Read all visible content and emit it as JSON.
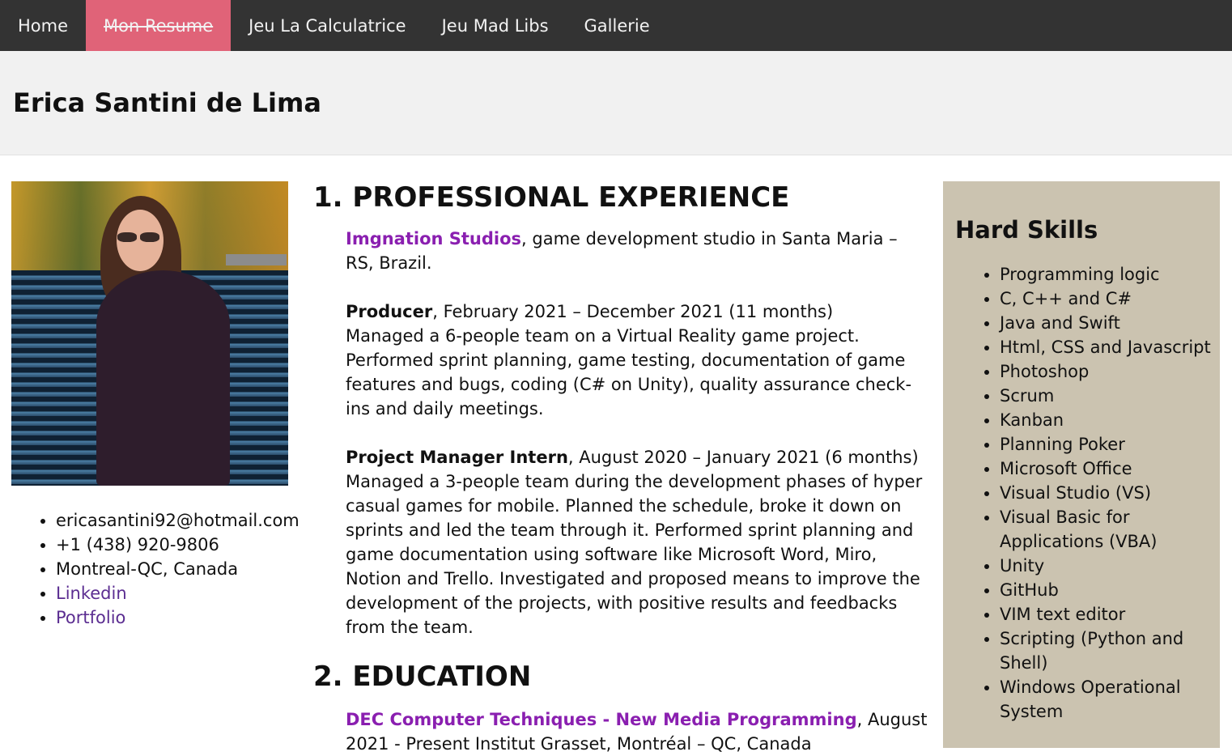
{
  "nav": {
    "items": [
      "Home",
      "Mon Resume",
      "Jeu La Calculatrice",
      "Jeu Mad Libs",
      "Gallerie"
    ],
    "active_color": "#e06378",
    "bar_color": "#333333"
  },
  "header": {
    "name": "Erica Santini de Lima"
  },
  "contact": {
    "email": "ericasantini92@hotmail.com",
    "phone": "+1 (438) 920-9806",
    "location": "Montreal-QC, Canada",
    "linkedin": "Linkedin",
    "portfolio": "Portfolio"
  },
  "experience": {
    "heading": "1. PROFESSIONAL EXPERIENCE",
    "company": "Imgnation Studios",
    "company_desc": ", game development studio in Santa Maria – RS, Brazil.",
    "job1_title": "Producer",
    "job1_period": ", February 2021 – December 2021 (11 months)",
    "job1_desc": "Managed a 6-people team on a Virtual Reality game project. Performed sprint planning, game testing, documentation of game features and bugs, coding (C# on Unity), quality assurance check-ins and daily meetings.",
    "job2_title": "Project Manager Intern",
    "job2_period": ", August 2020 – January 2021 (6 months)",
    "job2_desc": "Managed a 3-people team during the development phases of hyper casual games for mobile. Planned the schedule, broke it down on sprints and led the team through it. Performed sprint planning and game documentation using software like Microsoft Word, Miro, Notion and Trello. Investigated and proposed means to improve the development of the projects, with positive results and feedbacks from the team."
  },
  "education": {
    "heading": "2. EDUCATION",
    "program": "DEC Computer Techniques - New Media Programming",
    "program_rest": ", August 2021 - Present Institut Grasset, Montréal – QC, Canada"
  },
  "skills": {
    "heading": "Hard Skills",
    "items": [
      "Programming logic",
      "C, C++ and C#",
      "Java and Swift",
      "Html, CSS and Javascript",
      "Photoshop",
      "Scrum",
      "Kanban",
      "Planning Poker",
      "Microsoft Office",
      "Visual Studio (VS)",
      "Visual Basic for Applications (VBA)",
      "Unity",
      "GitHub",
      "VIM text editor",
      "Scripting (Python and Shell)",
      "Windows Operational System"
    ],
    "panel_color": "#cbc3b0"
  }
}
